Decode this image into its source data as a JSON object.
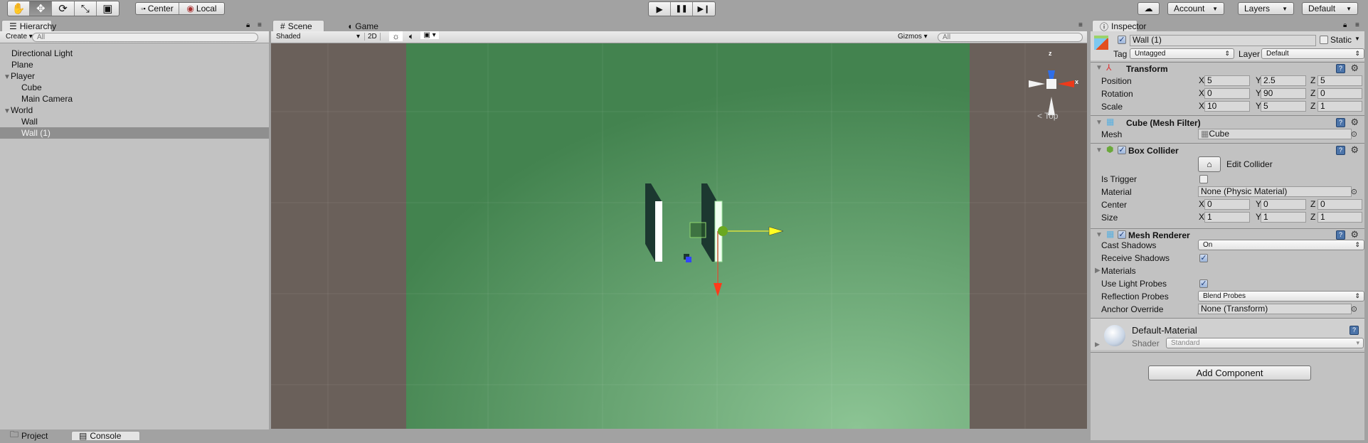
{
  "toolbar": {
    "tools": [
      {
        "name": "hand-tool",
        "icon": "✋",
        "active": false
      },
      {
        "name": "move-tool",
        "icon": "✥",
        "active": true
      },
      {
        "name": "rotate-tool",
        "icon": "⟳",
        "active": false
      },
      {
        "name": "scale-tool",
        "icon": "⤡",
        "active": false
      },
      {
        "name": "rect-tool",
        "icon": "▣",
        "active": false
      }
    ],
    "pivot": "Center",
    "space": "Local",
    "play_icon": "▶",
    "pause_icon": "❚❚",
    "step_icon": "▶❙",
    "account": "Account",
    "layers": "Layers",
    "layout": "Default"
  },
  "hierarchy": {
    "tab": "Hierarchy",
    "create": "Create",
    "search_placeholder": "All",
    "items": [
      {
        "label": "Directional Light",
        "depth": 0
      },
      {
        "label": "Plane",
        "depth": 0
      },
      {
        "label": "Player",
        "depth": 0,
        "expanded": true
      },
      {
        "label": "Cube",
        "depth": 1
      },
      {
        "label": "Main Camera",
        "depth": 1
      },
      {
        "label": "World",
        "depth": 0,
        "expanded": true
      },
      {
        "label": "Wall",
        "depth": 1
      },
      {
        "label": "Wall (1)",
        "depth": 1,
        "selected": true
      }
    ]
  },
  "scene": {
    "tabs": [
      "Scene",
      "Game"
    ],
    "active_tab": "Scene",
    "shading": "Shaded",
    "mode_2d": "2D",
    "gizmos": "Gizmos",
    "search_placeholder": "All",
    "view_label": "Top",
    "axis_x": "x",
    "axis_z": "z",
    "colors": {
      "background": "#6a605a",
      "ground": "#4e8a5c"
    }
  },
  "inspector": {
    "tab": "Inspector",
    "object_name": "Wall (1)",
    "active": true,
    "static_label": "Static",
    "static": false,
    "tag_label": "Tag",
    "tag": "Untagged",
    "layer_label": "Layer",
    "layer": "Default",
    "transform": {
      "title": "Transform",
      "rows": [
        {
          "label": "Position",
          "x": "5",
          "y": "2.5",
          "z": "5"
        },
        {
          "label": "Rotation",
          "x": "0",
          "y": "90",
          "z": "0"
        },
        {
          "label": "Scale",
          "x": "10",
          "y": "5",
          "z": "1"
        }
      ]
    },
    "mesh_filter": {
      "title": "Cube (Mesh Filter)",
      "mesh_label": "Mesh",
      "mesh": "Cube"
    },
    "box_collider": {
      "title": "Box Collider",
      "enabled": true,
      "edit_collider": "Edit Collider",
      "is_trigger_label": "Is Trigger",
      "is_trigger": false,
      "material_label": "Material",
      "material": "None (Physic Material)",
      "center_label": "Center",
      "center": {
        "x": "0",
        "y": "0",
        "z": "0"
      },
      "size_label": "Size",
      "size": {
        "x": "1",
        "y": "1",
        "z": "1"
      }
    },
    "mesh_renderer": {
      "title": "Mesh Renderer",
      "enabled": true,
      "cast_shadows_label": "Cast Shadows",
      "cast_shadows": "On",
      "receive_shadows_label": "Receive Shadows",
      "receive_shadows": true,
      "materials_label": "Materials",
      "light_probes_label": "Use Light Probes",
      "light_probes": true,
      "reflection_probes_label": "Reflection Probes",
      "reflection_probes": "Blend Probes",
      "anchor_override_label": "Anchor Override",
      "anchor_override": "None (Transform)"
    },
    "material": {
      "name": "Default-Material",
      "shader_label": "Shader",
      "shader": "Standard"
    },
    "add_component": "Add Component"
  },
  "bottom": {
    "tabs": [
      "Project",
      "Console"
    ],
    "active_tab": "Console"
  }
}
